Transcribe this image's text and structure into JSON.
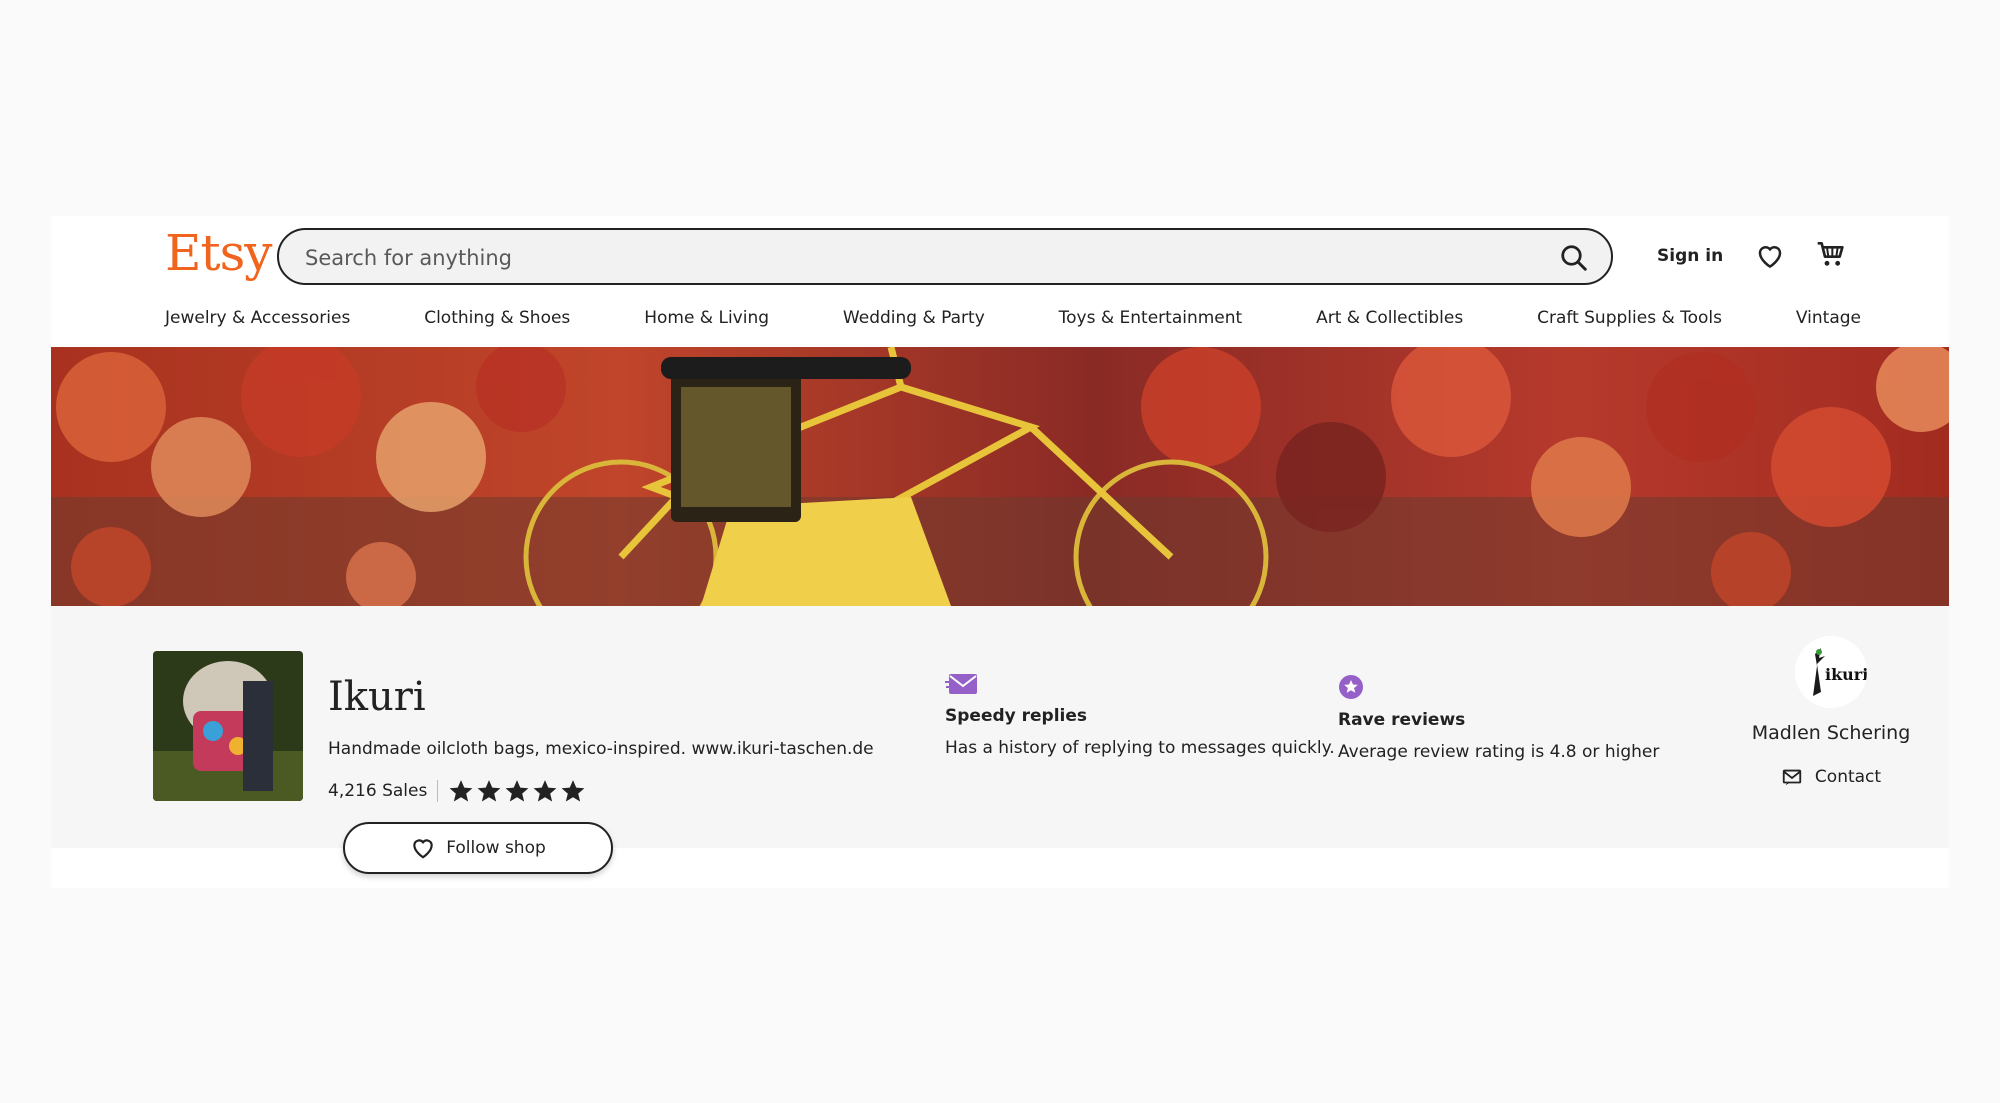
{
  "header": {
    "logo": "Etsy",
    "search_placeholder": "Search for anything",
    "sign_in": "Sign in"
  },
  "categories": [
    "Jewelry & Accessories",
    "Clothing & Shoes",
    "Home & Living",
    "Wedding & Party",
    "Toys & Entertainment",
    "Art & Collectibles",
    "Craft Supplies & Tools",
    "Vintage"
  ],
  "shop": {
    "name": "Ikuri",
    "tagline": "Handmade oilcloth bags, mexico-inspired. www.ikuri-taschen.de",
    "sales": "4,216 Sales",
    "rating_stars": 5,
    "follow_label": "Follow shop"
  },
  "badges": [
    {
      "title": "Speedy replies",
      "desc": "Has a history of replying to messages quickly.",
      "icon": "envelope-icon"
    },
    {
      "title": "Rave reviews",
      "desc": "Average review rating is 4.8 or higher",
      "icon": "star-badge-icon"
    }
  ],
  "owner": {
    "name": "Madlen Schering",
    "avatar_text": "ikuri",
    "contact_label": "Contact"
  },
  "colors": {
    "brand": "#f1641e",
    "badge": "#9560c8"
  }
}
